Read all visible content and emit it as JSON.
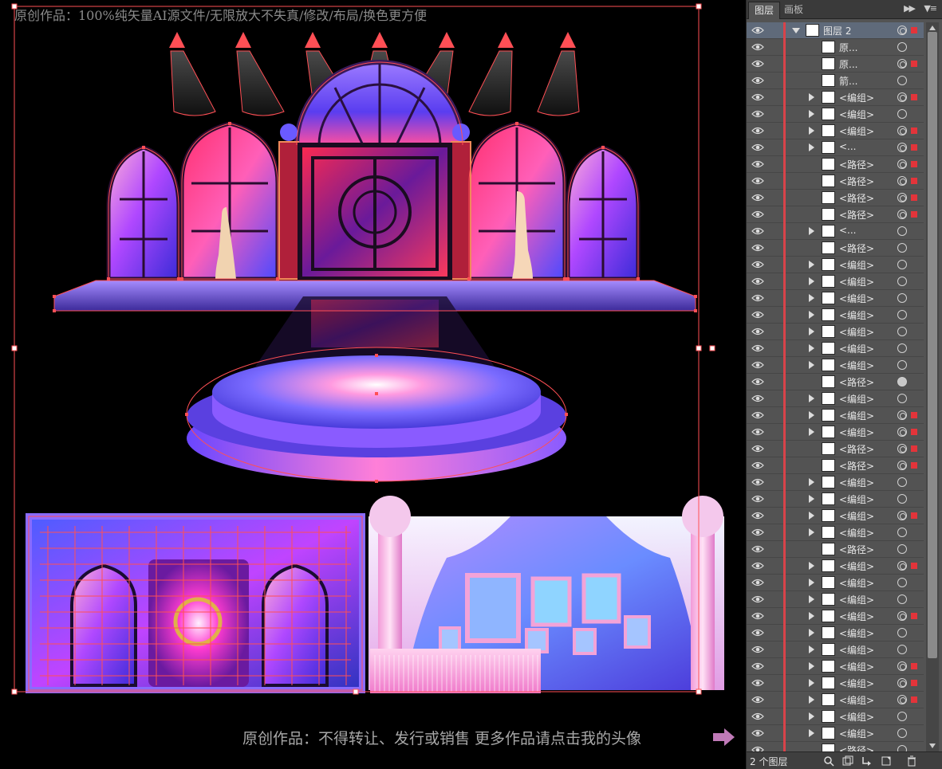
{
  "canvas": {
    "watermark_top": "原创作品：100%纯矢量AI源文件/无限放大不失真/修改/布局/换色更方便",
    "watermark_bottom": "原创作品：不得转让、发行或销售 更多作品请点击我的头像",
    "arrow_icon": "arrow-right-icon",
    "colors": {
      "selection": "#ff4f55",
      "accent_pink": "#ff3da0",
      "accent_purple": "#7a4bff"
    }
  },
  "panel": {
    "tabs": [
      {
        "label": "图层",
        "active": true
      },
      {
        "label": "画板",
        "active": false
      }
    ],
    "layer_name": "图层 2",
    "footer_count": "2 个图层",
    "rows": [
      {
        "label": "原...",
        "exp": false,
        "t": "o"
      },
      {
        "label": "原...",
        "exp": false,
        "t": "d"
      },
      {
        "label": "箭...",
        "exp": false,
        "t": "o"
      },
      {
        "label": "<编组>",
        "exp": true,
        "t": "d"
      },
      {
        "label": "<编组>",
        "exp": true,
        "t": "o"
      },
      {
        "label": "<编组>",
        "exp": true,
        "t": "d"
      },
      {
        "label": "<...",
        "exp": true,
        "t": "d"
      },
      {
        "label": "<路径>",
        "exp": false,
        "t": "d"
      },
      {
        "label": "<路径>",
        "exp": false,
        "t": "d"
      },
      {
        "label": "<路径>",
        "exp": false,
        "t": "d"
      },
      {
        "label": "<路径>",
        "exp": false,
        "t": "d"
      },
      {
        "label": "<...",
        "exp": true,
        "t": "o"
      },
      {
        "label": "<路径>",
        "exp": false,
        "t": "o"
      },
      {
        "label": "<编组>",
        "exp": true,
        "t": "o"
      },
      {
        "label": "<编组>",
        "exp": true,
        "t": "o"
      },
      {
        "label": "<编组>",
        "exp": true,
        "t": "o"
      },
      {
        "label": "<编组>",
        "exp": true,
        "t": "o"
      },
      {
        "label": "<编组>",
        "exp": true,
        "t": "o"
      },
      {
        "label": "<编组>",
        "exp": true,
        "t": "o"
      },
      {
        "label": "<编组>",
        "exp": true,
        "t": "o"
      },
      {
        "label": "<路径>",
        "exp": false,
        "t": "f"
      },
      {
        "label": "<编组>",
        "exp": true,
        "t": "o"
      },
      {
        "label": "<编组>",
        "exp": true,
        "t": "d"
      },
      {
        "label": "<编组>",
        "exp": true,
        "t": "d"
      },
      {
        "label": "<路径>",
        "exp": false,
        "t": "d"
      },
      {
        "label": "<路径>",
        "exp": false,
        "t": "d"
      },
      {
        "label": "<编组>",
        "exp": true,
        "t": "o"
      },
      {
        "label": "<编组>",
        "exp": true,
        "t": "o"
      },
      {
        "label": "<编组>",
        "exp": true,
        "t": "d"
      },
      {
        "label": "<编组>",
        "exp": true,
        "t": "o"
      },
      {
        "label": "<路径>",
        "exp": false,
        "t": "o"
      },
      {
        "label": "<编组>",
        "exp": true,
        "t": "d"
      },
      {
        "label": "<编组>",
        "exp": true,
        "t": "o"
      },
      {
        "label": "<编组>",
        "exp": true,
        "t": "o"
      },
      {
        "label": "<编组>",
        "exp": true,
        "t": "d"
      },
      {
        "label": "<编组>",
        "exp": true,
        "t": "o"
      },
      {
        "label": "<编组>",
        "exp": true,
        "t": "o"
      },
      {
        "label": "<编组>",
        "exp": true,
        "t": "d"
      },
      {
        "label": "<编组>",
        "exp": true,
        "t": "d"
      },
      {
        "label": "<编组>",
        "exp": true,
        "t": "d"
      },
      {
        "label": "<编组>",
        "exp": true,
        "t": "o"
      },
      {
        "label": "<编组>",
        "exp": true,
        "t": "o"
      },
      {
        "label": "<路径>",
        "exp": false,
        "t": "o"
      }
    ],
    "icons": [
      "eye-icon",
      "disclosure-triangle-icon",
      "target-circle-icon",
      "selection-square-icon"
    ],
    "footer_icons": [
      "search-icon",
      "make-clipping-mask-icon",
      "new-sublayer-icon",
      "new-layer-icon",
      "trash-icon"
    ]
  }
}
